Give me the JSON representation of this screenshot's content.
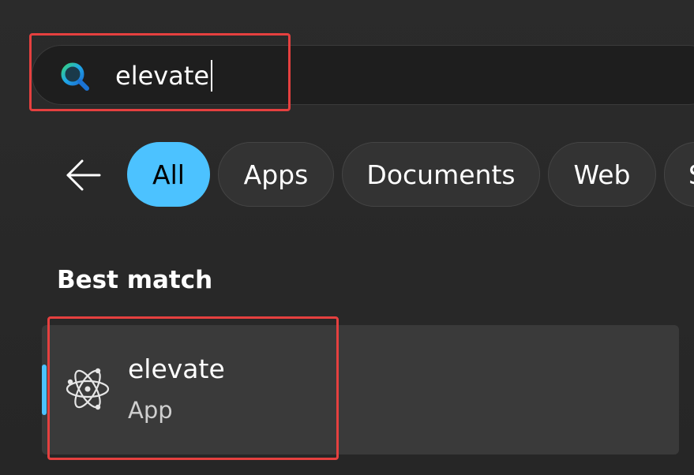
{
  "search": {
    "query": "elevate",
    "icon": "search-icon"
  },
  "filters": {
    "back_icon": "back-arrow-icon",
    "chips": [
      {
        "label": "All",
        "active": true
      },
      {
        "label": "Apps",
        "active": false
      },
      {
        "label": "Documents",
        "active": false
      },
      {
        "label": "Web",
        "active": false
      },
      {
        "label": "S",
        "active": false
      }
    ]
  },
  "best_match": {
    "title": "Best match",
    "result": {
      "name": "elevate",
      "type": "App",
      "icon": "electron-app-icon"
    }
  },
  "colors": {
    "accent": "#4cc2ff",
    "highlight": "#e5403f",
    "background": "#272727"
  }
}
